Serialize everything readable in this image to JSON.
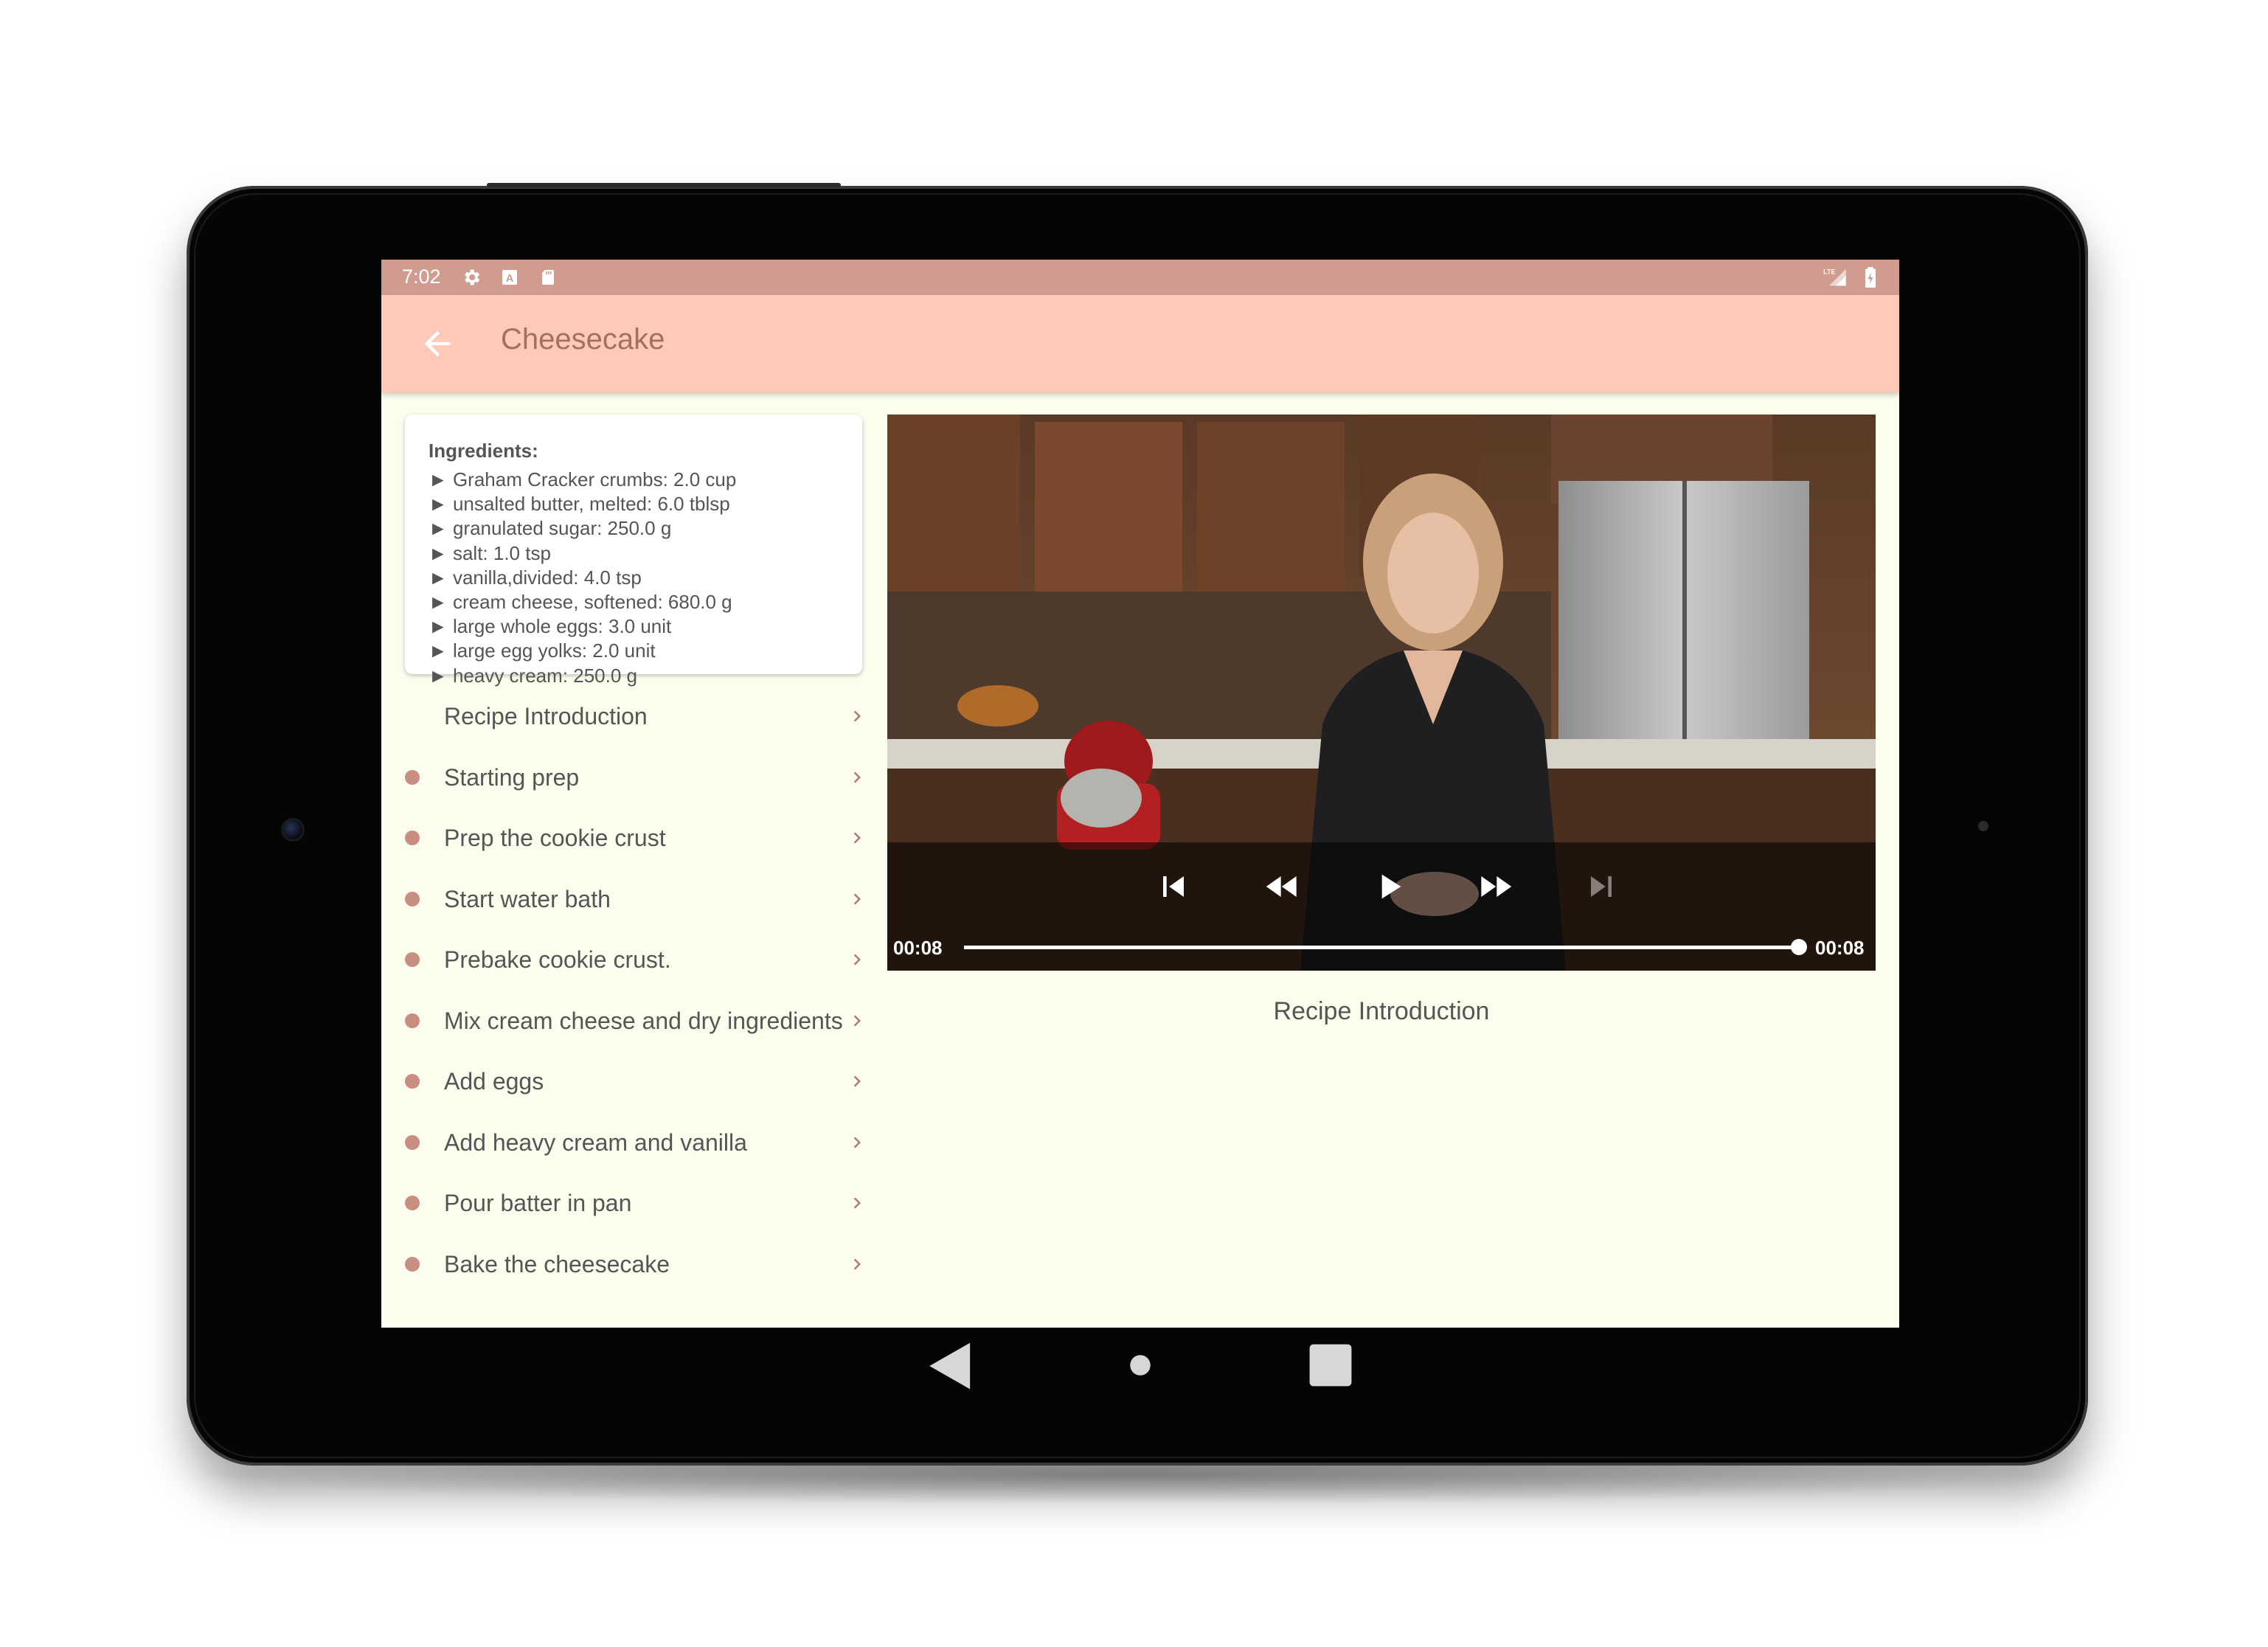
{
  "status_bar": {
    "time": "7:02",
    "left_icons": [
      "gear-icon",
      "a-box-icon",
      "sd-card-icon"
    ],
    "right_icons": [
      "lte-signal-icon",
      "battery-charging-icon"
    ],
    "color": "#cf9c8f"
  },
  "app_bar": {
    "title": "Cheesecake",
    "back_icon": "arrow-left-icon",
    "color": "#ffc9b8"
  },
  "ingredients": {
    "title": "Ingredients:",
    "items": [
      "► Graham Cracker crumbs: 2.0 cup",
      "► unsalted butter, melted: 6.0 tblsp",
      "► granulated sugar: 250.0 g",
      "► salt: 1.0 tsp",
      "► vanilla,divided: 4.0 tsp",
      "► cream cheese, softened: 680.0 g",
      "► large whole eggs: 3.0 unit",
      "► large egg yolks: 2.0 unit",
      "► heavy cream: 250.0 g"
    ]
  },
  "steps": [
    {
      "label": "Recipe Introduction",
      "bullet": false
    },
    {
      "label": "Starting prep",
      "bullet": true
    },
    {
      "label": "Prep the cookie crust",
      "bullet": true
    },
    {
      "label": "Start water bath",
      "bullet": true
    },
    {
      "label": "Prebake cookie crust.",
      "bullet": true
    },
    {
      "label": "Mix cream cheese and dry ingredients",
      "bullet": true
    },
    {
      "label": "Add eggs",
      "bullet": true
    },
    {
      "label": "Add heavy cream and vanilla",
      "bullet": true
    },
    {
      "label": "Pour batter in pan",
      "bullet": true
    },
    {
      "label": "Bake the cheesecake",
      "bullet": true
    }
  ],
  "player": {
    "position": "00:08",
    "duration": "00:08",
    "progress": 1.0,
    "controls": [
      "skip-previous-icon",
      "rewind-icon",
      "play-icon",
      "fast-forward-icon",
      "skip-next-icon"
    ]
  },
  "step_description": "Recipe Introduction",
  "nav_bar": {
    "icons": [
      "back-triangle-icon",
      "home-circle-icon",
      "recents-square-icon"
    ]
  },
  "colors": {
    "accent": "#c98e82",
    "background": "#fdfdee",
    "title_text": "#a56f5f"
  }
}
